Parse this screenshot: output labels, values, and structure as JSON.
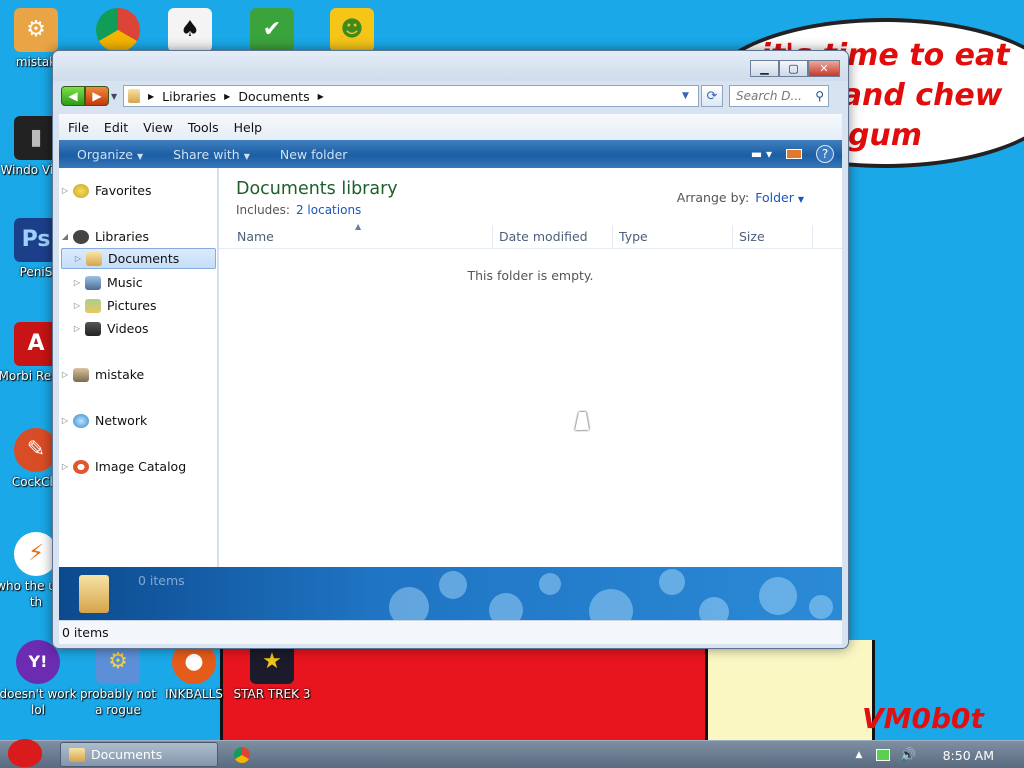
{
  "desktop": {
    "bubble_text": "it's time to eat shit and chew gum",
    "watermark": "VM0b0t",
    "icons": [
      {
        "label": "mistak",
        "color": "#e9a445",
        "glyph": "⚙"
      },
      {
        "label": "",
        "color": "#ffffff",
        "glyph": "◉"
      },
      {
        "label": "",
        "color": "#f4f4f4",
        "glyph": "♠"
      },
      {
        "label": "",
        "color": "#3ba33b",
        "glyph": "✔"
      },
      {
        "label": "",
        "color": "#f5c518",
        "glyph": "☻"
      },
      {
        "label": "Windo Vista",
        "color": "#222222",
        "glyph": "▮"
      },
      {
        "label": "PeniS",
        "color": "#1c3f8a",
        "glyph": "Ps"
      },
      {
        "label": "Morbi Reade",
        "color": "#c81414",
        "glyph": "A"
      },
      {
        "label": "CockCle",
        "color": "#d94d26",
        "glyph": "✎"
      },
      {
        "label": "who the uses th",
        "color": "#ffffff",
        "glyph": "⚡"
      },
      {
        "label": "doesn't work lol",
        "color": "#6c2bb3",
        "glyph": "Y!"
      },
      {
        "label": "probably not a rogue",
        "color": "#5d8fd8",
        "glyph": "⚙"
      },
      {
        "label": "INKBALLS",
        "color": "#e55b1a",
        "glyph": "●"
      },
      {
        "label": "STAR TREK 3",
        "color": "#1b1b2b",
        "glyph": "★"
      }
    ]
  },
  "window": {
    "title": "Documents",
    "address": {
      "segments": [
        "Libraries",
        "Documents"
      ]
    },
    "search_placeholder": "Search D...",
    "menu": [
      "File",
      "Edit",
      "View",
      "Tools",
      "Help"
    ],
    "commands": [
      "Organize",
      "Share with",
      "New folder"
    ],
    "nav": {
      "favorites": "Favorites",
      "libraries": "Libraries",
      "documents": "Documents",
      "music": "Music",
      "pictures": "Pictures",
      "videos": "Videos",
      "mistake": "mistake",
      "network": "Network",
      "image_catalog": "Image Catalog"
    },
    "library": {
      "title": "Documents library",
      "includes_label": "Includes:",
      "includes_link": "2 locations",
      "arrange_label": "Arrange by:",
      "arrange_value": "Folder"
    },
    "columns": [
      "Name",
      "Date modified",
      "Type",
      "Size"
    ],
    "empty_message": "This folder is empty.",
    "details_count": "0 items",
    "status": "0 items"
  },
  "taskbar": {
    "task_label": "Documents",
    "clock": "8:50 AM"
  }
}
